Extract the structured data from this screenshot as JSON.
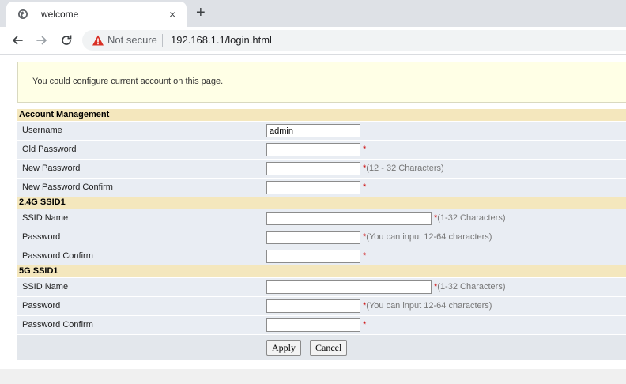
{
  "browser": {
    "tab_title": "welcome",
    "tab_close": "×",
    "new_tab": "+",
    "security_label": "Not secure",
    "url": "192.168.1.1/login.html",
    "warning_color": "#d93025"
  },
  "notice": {
    "text": "You could configure current account on this page."
  },
  "sections": {
    "account": {
      "title": "Account Management",
      "username_label": "Username",
      "username_value": "admin",
      "old_password_label": "Old Password",
      "old_password_hint": "*",
      "new_password_label": "New Password",
      "new_password_hint_mark": "*",
      "new_password_hint": "(12 - 32 Characters)",
      "confirm_label": "New Password Confirm",
      "confirm_hint": "*"
    },
    "ssid24": {
      "title": "2.4G SSID1",
      "ssid_label": "SSID Name",
      "ssid_hint_mark": "*",
      "ssid_hint": "(1-32 Characters)",
      "password_label": "Password",
      "password_hint_mark": "*",
      "password_hint": "(You can input 12-64 characters)",
      "confirm_label": "Password Confirm",
      "confirm_hint": "*"
    },
    "ssid5": {
      "title": "5G SSID1",
      "ssid_label": "SSID Name",
      "ssid_hint_mark": "*",
      "ssid_hint": "(1-32 Characters)",
      "password_label": "Password",
      "password_hint_mark": "*",
      "password_hint": "(You can input 12-64 characters)",
      "confirm_label": "Password Confirm",
      "confirm_hint": "*"
    }
  },
  "buttons": {
    "apply": "Apply",
    "cancel": "Cancel"
  },
  "colors": {
    "section_bg": "#f4e7bd",
    "row_bg": "#e9edf3",
    "notice_bg": "#ffffe6",
    "required_mark": "#cc0000"
  }
}
